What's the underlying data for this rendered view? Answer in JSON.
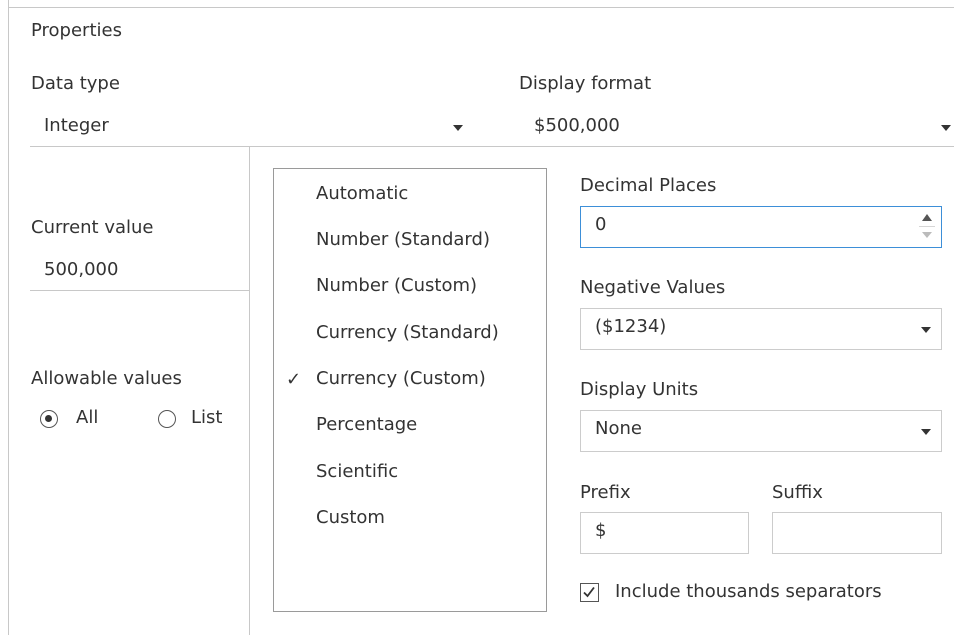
{
  "panel": {
    "title": "Properties",
    "data_type": {
      "label": "Data type",
      "value": "Integer"
    },
    "display_format": {
      "label": "Display format",
      "value": "$500,000"
    },
    "current_value": {
      "label": "Current value",
      "value": "500,000"
    },
    "allowable_values": {
      "label": "Allowable values",
      "options": [
        {
          "label": "All",
          "selected": true
        },
        {
          "label": "List",
          "selected": false
        }
      ]
    }
  },
  "format_menu": {
    "items": [
      {
        "label": "Automatic",
        "checked": false
      },
      {
        "label": "Number (Standard)",
        "checked": false
      },
      {
        "label": "Number (Custom)",
        "checked": false
      },
      {
        "label": "Currency (Standard)",
        "checked": false
      },
      {
        "label": "Currency (Custom)",
        "checked": true
      },
      {
        "label": "Percentage",
        "checked": false
      },
      {
        "label": "Scientific",
        "checked": false
      },
      {
        "label": "Custom",
        "checked": false
      }
    ],
    "check_glyph": "✓"
  },
  "currency_options": {
    "decimal_places": {
      "label": "Decimal Places",
      "value": "0"
    },
    "negative_values": {
      "label": "Negative Values",
      "value": "($1234)"
    },
    "display_units": {
      "label": "Display Units",
      "value": "None"
    },
    "prefix": {
      "label": "Prefix",
      "value": "$"
    },
    "suffix": {
      "label": "Suffix",
      "value": ""
    },
    "thousands_separators": {
      "label": "Include thousands separators",
      "checked": true
    }
  },
  "colors": {
    "focus_border": "#3d8fd8",
    "border": "#cccccc",
    "text": "#333333"
  }
}
